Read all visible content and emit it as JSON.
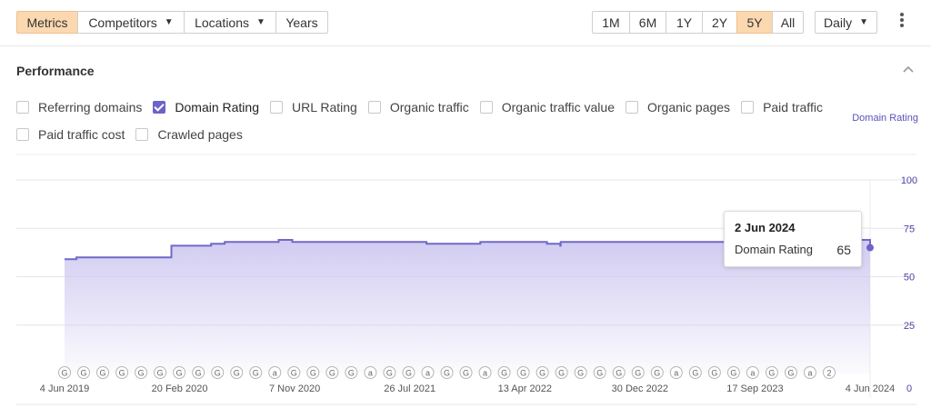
{
  "toolbar": {
    "tabs": [
      {
        "label": "Metrics",
        "active": true
      },
      {
        "label": "Competitors",
        "dropdown": true
      },
      {
        "label": "Locations",
        "dropdown": true
      },
      {
        "label": "Years"
      }
    ],
    "ranges": [
      "1M",
      "6M",
      "1Y",
      "2Y",
      "5Y",
      "All"
    ],
    "active_range": "5Y",
    "interval": "Daily"
  },
  "section": {
    "title": "Performance",
    "metrics": [
      {
        "label": "Referring domains",
        "checked": false
      },
      {
        "label": "Domain Rating",
        "checked": true
      },
      {
        "label": "URL Rating",
        "checked": false
      },
      {
        "label": "Organic traffic",
        "checked": false
      },
      {
        "label": "Organic traffic value",
        "checked": false
      },
      {
        "label": "Organic pages",
        "checked": false
      },
      {
        "label": "Paid traffic",
        "checked": false
      },
      {
        "label": "Paid traffic cost",
        "checked": false
      },
      {
        "label": "Crawled pages",
        "checked": false
      }
    ],
    "series_label": "Domain Rating"
  },
  "tooltip": {
    "date": "2 Jun 2024",
    "metric": "Domain Rating",
    "value": "65"
  },
  "colors": {
    "accent": "#6c63c9",
    "area": "#d9d5f3",
    "active_button": "#fbd8b0"
  },
  "chart_data": {
    "type": "area",
    "series": [
      {
        "name": "Domain Rating",
        "x": [
          "2019-06-04",
          "2019-06-10",
          "2019-07-01",
          "2019-07-15",
          "2019-09-01",
          "2019-12-01",
          "2020-02-01",
          "2020-03-01",
          "2020-05-01",
          "2020-06-01",
          "2020-07-01",
          "2020-09-01",
          "2020-10-01",
          "2020-11-01",
          "2021-01-01",
          "2021-05-01",
          "2021-09-01",
          "2022-01-01",
          "2022-04-01",
          "2022-06-01",
          "2022-07-01",
          "2022-07-02",
          "2022-10-01",
          "2023-01-01",
          "2023-05-01",
          "2023-08-01",
          "2023-10-01",
          "2024-01-01",
          "2024-03-01",
          "2024-05-01",
          "2024-06-02"
        ],
        "values": [
          59,
          59,
          60,
          60,
          60,
          60,
          66,
          66,
          67,
          68,
          68,
          68,
          69,
          68,
          68,
          68,
          67,
          68,
          68,
          67,
          66,
          68,
          68,
          68,
          68,
          68,
          68,
          68,
          69,
          69,
          65
        ]
      }
    ],
    "xlabel_ticks": [
      "4 Jun 2019",
      "20 Feb 2020",
      "7 Nov 2020",
      "26 Jul 2021",
      "13 Apr 2022",
      "30 Dec 2022",
      "17 Sep 2023",
      "4 Jun 2024"
    ],
    "y_ticks": [
      "100",
      "75",
      "50",
      "25",
      "0"
    ],
    "ylim": [
      0,
      100
    ],
    "grid": true,
    "annotations": [
      "G",
      "G",
      "G",
      "G",
      "G",
      "G",
      "G",
      "G",
      "G",
      "G",
      "G",
      "a",
      "G",
      "G",
      "G",
      "G",
      "a",
      "G",
      "G",
      "a",
      "G",
      "G",
      "a",
      "G",
      "G",
      "G",
      "G",
      "G",
      "G",
      "G",
      "G",
      "G",
      "a",
      "G",
      "G",
      "G",
      "a",
      "G",
      "G",
      "a",
      "2"
    ]
  }
}
